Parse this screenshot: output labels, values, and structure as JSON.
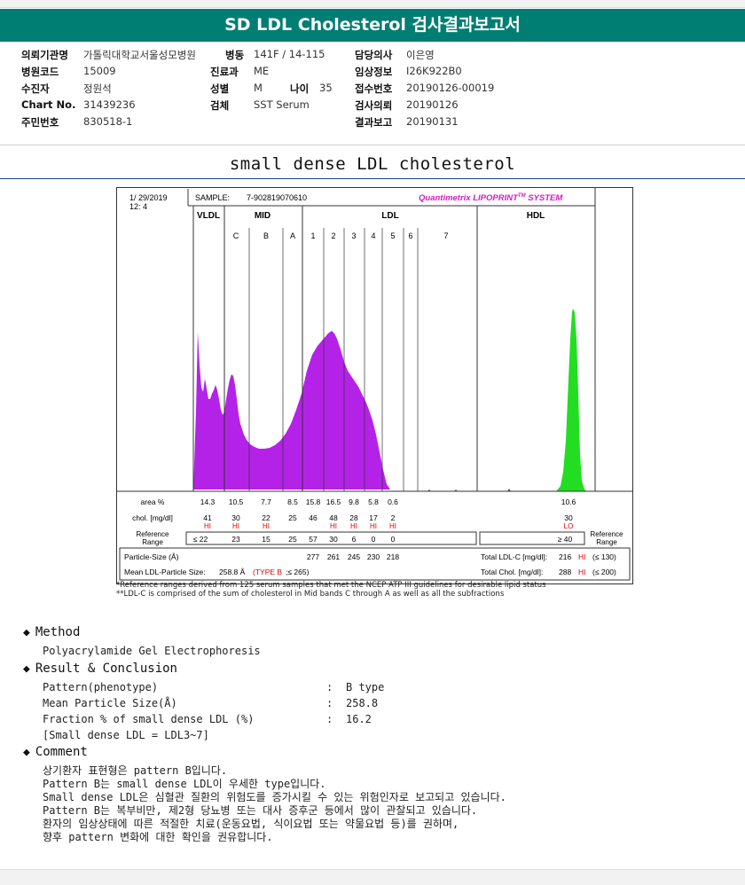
{
  "title": "SD LDL Cholesterol 검사결과보고서",
  "patient_info": {
    "hospital_label": "의뢰기관명",
    "hospital": "가톨릭대학교서울성모병원",
    "ward_label": "병동",
    "ward": "141F / 14-115",
    "doctor_label": "담당의사",
    "doctor": "이은영",
    "code_label": "병원코드",
    "code": "15009",
    "dept_label": "진료과",
    "dept": "ME",
    "clinical_label": "임상정보",
    "clinical": "I26K922B0",
    "examinee_label": "수진자",
    "examinee": "정원석",
    "sex_label": "성별",
    "sex": "M",
    "age_label": "나이",
    "age": "35",
    "receipt_label": "접수번호",
    "receipt": "20190126-00019",
    "chart_label": "Chart No.",
    "chart": "31439236",
    "specimen_label": "검체",
    "specimen": "SST Serum",
    "request_label": "검사의뢰",
    "request": "20190126",
    "resident_label": "주민번호",
    "resident": "830518-1",
    "result_label": "결과보고",
    "result": "20190131"
  },
  "section_title": "small dense LDL cholesterol",
  "report": {
    "date": "1/ 29/2019",
    "time": "12: 4",
    "sample_label": "SAMPLE:",
    "sample_id": "7-902819070610",
    "brand": "Quantimetrix LIPOPRINT",
    "brand_tm": "TM",
    "brand_suffix": "SYSTEM",
    "bands": {
      "vldl": "VLDL",
      "mid": "MID",
      "ldl": "LDL",
      "hdl": "HDL",
      "sub": [
        "C",
        "B",
        "A",
        "1",
        "2",
        "3",
        "4",
        "5",
        "6",
        "7"
      ]
    },
    "rows": {
      "area_label": "area %",
      "area": [
        "14.3",
        "10.5",
        "7.7",
        "8.5",
        "15.8",
        "16.5",
        "9.8",
        "5.8",
        "0.6"
      ],
      "area_hdl": "10.6",
      "chol_label": "chol. [mg/dl]",
      "chol": [
        "41",
        "30",
        "22",
        "25",
        "46",
        "48",
        "28",
        "17",
        "2"
      ],
      "chol_flags": [
        "HI",
        "HI",
        "HI",
        "",
        "",
        "HI",
        "HI",
        "HI",
        "HI"
      ],
      "chol_hdl": "30",
      "chol_hdl_flag": "LO",
      "ref_label1": "Reference",
      "ref_label2": "Range",
      "ref": [
        "≤  22",
        "23",
        "15",
        "25",
        "57",
        "30",
        "6",
        "0",
        "0"
      ],
      "ref_hdl": "≥ 40",
      "ref_right1": "Reference",
      "ref_right2": "Range",
      "size_label": "Particle-Size (Å)",
      "sizes": [
        "277",
        "261",
        "245",
        "230",
        "218"
      ],
      "mean_label": "Mean LDL-Particle Size:",
      "mean_value": "258.8 Å",
      "mean_type": "(TYPE B",
      "mean_ref": ";≤ 265)",
      "total_ldl_label": "Total LDL-C [mg/dl]:",
      "total_ldl": "216",
      "total_ldl_flag": "HI",
      "total_ldl_ref": "(≤ 130)",
      "total_chol_label": "Total Chol. [mg/dl]:",
      "total_chol": "288",
      "total_chol_flag": "HI",
      "total_chol_ref": "(≤ 200)"
    }
  },
  "footnotes": [
    "*Reference ranges derived from 125 serum samples that met the NCEP ATP III guidelines for desirable lipid status",
    "**LDL-C is comprised of the sum of cholesterol in Mid bands C through A as well as all the subfractions"
  ],
  "method": {
    "heading": "Method",
    "text": "Polyacrylamide Gel Electrophoresis"
  },
  "result": {
    "heading": "Result & Conclusion",
    "items": [
      {
        "label": "Pattern(phenotype)",
        "value": "B type"
      },
      {
        "label": "Mean Particle Size(Å)",
        "value": "258.8"
      },
      {
        "label": "Fraction % of small dense LDL (%)",
        "value": "16.2"
      }
    ],
    "note": "[Small dense LDL = LDL3~7]"
  },
  "comment": {
    "heading": "Comment",
    "lines": [
      "상기환자 표현형은 pattern B입니다.",
      "Pattern B는 small dense LDL이 우세한 type입니다.",
      "Small dense LDL은 심혈관 질환의 위험도를 증가시킬 수 있는 위험인자로 보고되고 있습니다.",
      "Pattern B는 복부비만, 제2형 당뇨병 또는 대사 증후군 등에서 많이 관찰되고 있습니다.",
      "환자의 임상상태에 따른 적절한 치료(운동요법, 식이요법 또는 약물요법 등)를 권하며,",
      "향후 pattern 변화에 대한 확인을 권유합니다."
    ]
  },
  "colors": {
    "title_bg": "#007e73",
    "flag": "#e00000",
    "brand": "#d020c0"
  }
}
